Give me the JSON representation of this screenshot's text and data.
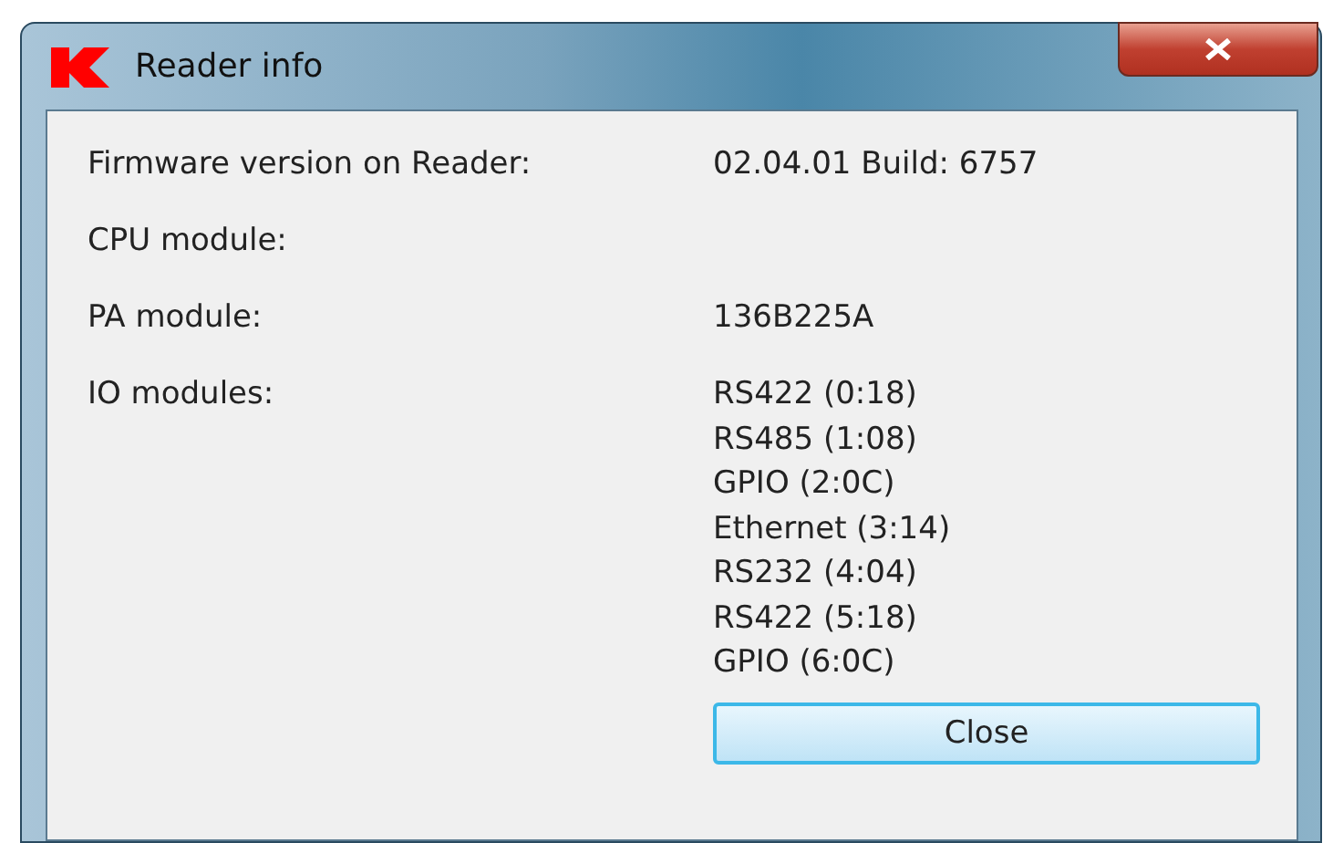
{
  "window": {
    "title": "Reader info"
  },
  "fields": [
    {
      "label": "Firmware version on Reader:",
      "values": [
        "02.04.01 Build: 6757"
      ]
    },
    {
      "label": "CPU module:"
    },
    {
      "label": "PA module:",
      "values": [
        "136B225A"
      ]
    },
    {
      "label": "IO modules:",
      "values": [
        "RS422 (0:18)",
        "RS485 (1:08)",
        "GPIO (2:0C)",
        "Ethernet (3:14)",
        "RS232 (4:04)",
        "RS422 (5:18)",
        "GPIO (6:0C)"
      ]
    }
  ],
  "buttons": [
    "Close"
  ]
}
